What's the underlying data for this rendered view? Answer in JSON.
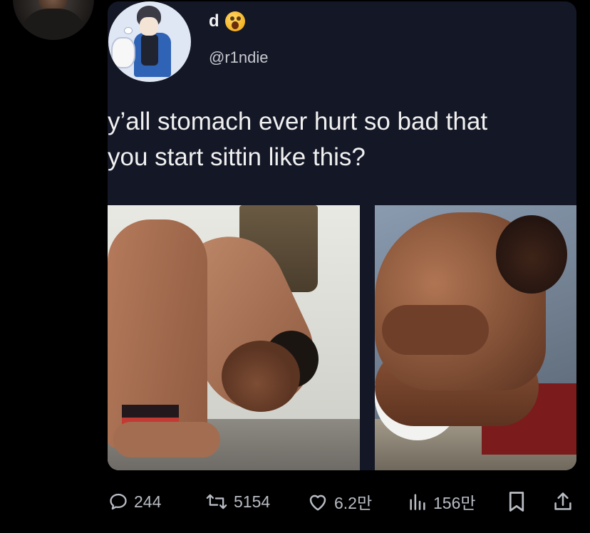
{
  "tweet": {
    "display_name": "d",
    "emoji_icon": "astonished-face-emoji",
    "handle": "@r1ndie",
    "text": "y’all stomach ever hurt so bad that\nyou start sittin like this?"
  },
  "actions": {
    "reply_count": "244",
    "retweet_count": "5154",
    "like_count": "6.2만",
    "view_count": "156만"
  },
  "colors": {
    "background": "#000000",
    "card": "#141726",
    "text": "#f0f0f0",
    "muted": "#b8bcc3"
  }
}
